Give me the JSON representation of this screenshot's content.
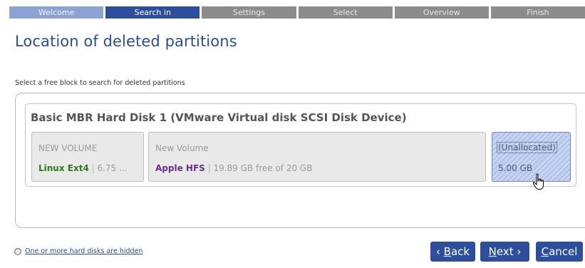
{
  "wizard_steps": [
    {
      "label": "Welcome",
      "state": "done"
    },
    {
      "label": "Search in",
      "state": "active"
    },
    {
      "label": "Settings",
      "state": "pending"
    },
    {
      "label": "Select",
      "state": "pending"
    },
    {
      "label": "Overview",
      "state": "pending"
    },
    {
      "label": "Finish",
      "state": "pending"
    }
  ],
  "page": {
    "title": "Location of deleted partitions",
    "instruction": "Select a free block to search for deleted partitions"
  },
  "disk": {
    "title": "Basic MBR Hard Disk 1 (VMware Virtual disk SCSI Disk Device)",
    "partitions": [
      {
        "name": "NEW VOLUME",
        "fs": "Linux Ext4",
        "sep": " | ",
        "detail": "6.75 ..."
      },
      {
        "name": "New Volume",
        "fs": "Apple HFS",
        "sep": " | ",
        "detail": "19.89 GB free of 20 GB"
      },
      {
        "name": "(Unallocated)",
        "size": "5.00 GB",
        "selected": true
      }
    ]
  },
  "footer": {
    "info_icon": "ⓘ",
    "hidden_link": "One or more hard disks are hidden",
    "back": {
      "prefix": "‹ ",
      "mnemonic": "B",
      "rest": "ack"
    },
    "next": {
      "mnemonic": "N",
      "rest": "ext ›"
    },
    "cancel": {
      "mnemonic": "C",
      "rest": "ancel"
    }
  },
  "colors": {
    "accent": "#2c4e9c",
    "step_done": "#8da2d4",
    "step_pending": "#8c8c8c",
    "ext4": "#2f7a1a",
    "hfs": "#6b2f88",
    "unallocated": "#b7c6ec"
  }
}
